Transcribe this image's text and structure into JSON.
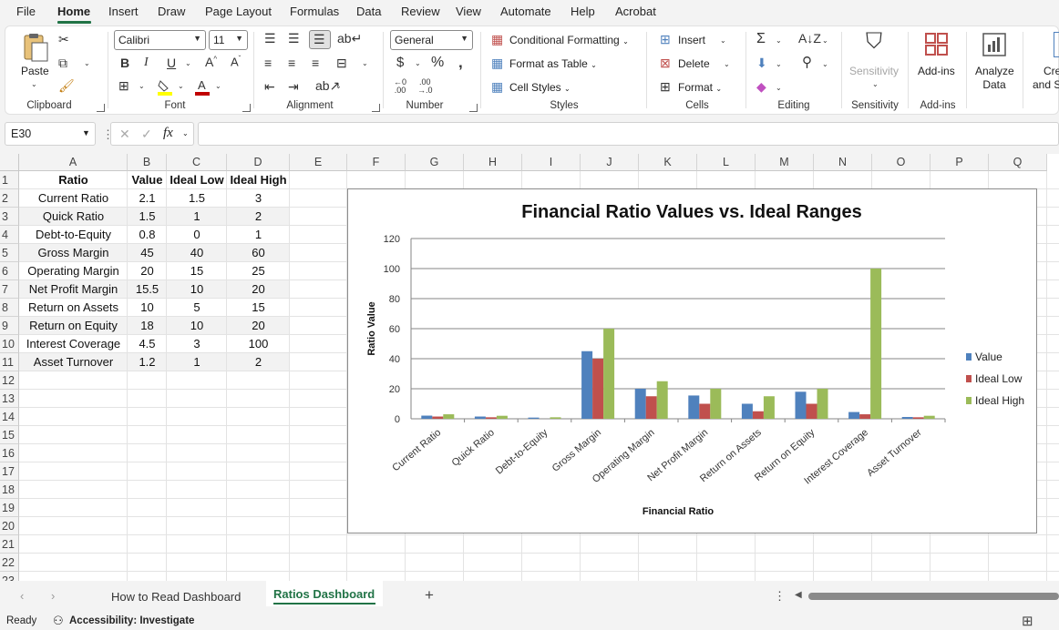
{
  "menu": {
    "items": [
      "File",
      "Home",
      "Insert",
      "Draw",
      "Page Layout",
      "Formulas",
      "Data",
      "Review",
      "View",
      "Automate",
      "Help",
      "Acrobat"
    ]
  },
  "ribbon": {
    "clipboard": {
      "paste": "Paste",
      "label": "Clipboard"
    },
    "font": {
      "name": "Calibri",
      "size": "11",
      "label": "Font"
    },
    "alignment": {
      "label": "Alignment"
    },
    "number": {
      "format": "General",
      "label": "Number"
    },
    "styles": {
      "conditional": "Conditional Formatting",
      "format_table": "Format as Table",
      "cell_styles": "Cell Styles",
      "label": "Styles"
    },
    "cells": {
      "insert": "Insert",
      "delete": "Delete",
      "format": "Format",
      "label": "Cells"
    },
    "editing": {
      "label": "Editing"
    },
    "sensitivity": {
      "button": "Sensitivity",
      "label": "Sensitivity"
    },
    "addins": {
      "button": "Add-ins",
      "label": "Add-ins"
    },
    "analyze": {
      "line1": "Analyze",
      "line2": "Data"
    },
    "create": {
      "line1": "Crea",
      "line2": "and S"
    }
  },
  "formula_bar": {
    "name_box": "E30",
    "fx": "fx",
    "content": ""
  },
  "columns": [
    "A",
    "B",
    "C",
    "D",
    "E",
    "F",
    "G",
    "H",
    "I",
    "J",
    "K",
    "L",
    "M",
    "N",
    "O",
    "P",
    "Q"
  ],
  "rows": [
    "1",
    "2",
    "3",
    "4",
    "5",
    "6",
    "7",
    "8",
    "9",
    "10",
    "11",
    "12",
    "13",
    "14",
    "15",
    "16",
    "17",
    "18",
    "19",
    "20",
    "21",
    "22",
    "23"
  ],
  "table": {
    "headers": [
      "Ratio",
      "Value",
      "Ideal Low",
      "Ideal High"
    ],
    "rows": [
      [
        "Current Ratio",
        "2.1",
        "1.5",
        "3"
      ],
      [
        "Quick Ratio",
        "1.5",
        "1",
        "2"
      ],
      [
        "Debt-to-Equity",
        "0.8",
        "0",
        "1"
      ],
      [
        "Gross Margin",
        "45",
        "40",
        "60"
      ],
      [
        "Operating Margin",
        "20",
        "15",
        "25"
      ],
      [
        "Net Profit Margin",
        "15.5",
        "10",
        "20"
      ],
      [
        "Return on Assets",
        "10",
        "5",
        "15"
      ],
      [
        "Return on Equity",
        "18",
        "10",
        "20"
      ],
      [
        "Interest Coverage",
        "4.5",
        "3",
        "100"
      ],
      [
        "Asset Turnover",
        "1.2",
        "1",
        "2"
      ]
    ]
  },
  "chart_data": {
    "type": "bar",
    "title": "Financial Ratio Values vs. Ideal Ranges",
    "xlabel": "Financial Ratio",
    "ylabel": "Ratio Value",
    "ylim": [
      0,
      120
    ],
    "yticks": [
      0,
      20,
      40,
      60,
      80,
      100,
      120
    ],
    "grid": true,
    "legend": "right",
    "categories": [
      "Current Ratio",
      "Quick Ratio",
      "Debt-to-Equity",
      "Gross Margin",
      "Operating Margin",
      "Net Profit Margin",
      "Return on Assets",
      "Return on Equity",
      "Interest Coverage",
      "Asset Turnover"
    ],
    "series": [
      {
        "name": "Value",
        "color": "#4f81bd",
        "values": [
          2.1,
          1.5,
          0.8,
          45,
          20,
          15.5,
          10,
          18,
          4.5,
          1.2
        ]
      },
      {
        "name": "Ideal Low",
        "color": "#c0504d",
        "values": [
          1.5,
          1,
          0,
          40,
          15,
          10,
          5,
          10,
          3,
          1
        ]
      },
      {
        "name": "Ideal High",
        "color": "#9bbb59",
        "values": [
          3,
          2,
          1,
          60,
          25,
          20,
          15,
          20,
          100,
          2
        ]
      }
    ]
  },
  "sheets": {
    "tabs": [
      "How to Read Dashboard",
      "Ratios Dashboard"
    ],
    "active": "Ratios Dashboard",
    "add": "+"
  },
  "status": {
    "ready": "Ready",
    "accessibility": "Accessibility: Investigate"
  }
}
